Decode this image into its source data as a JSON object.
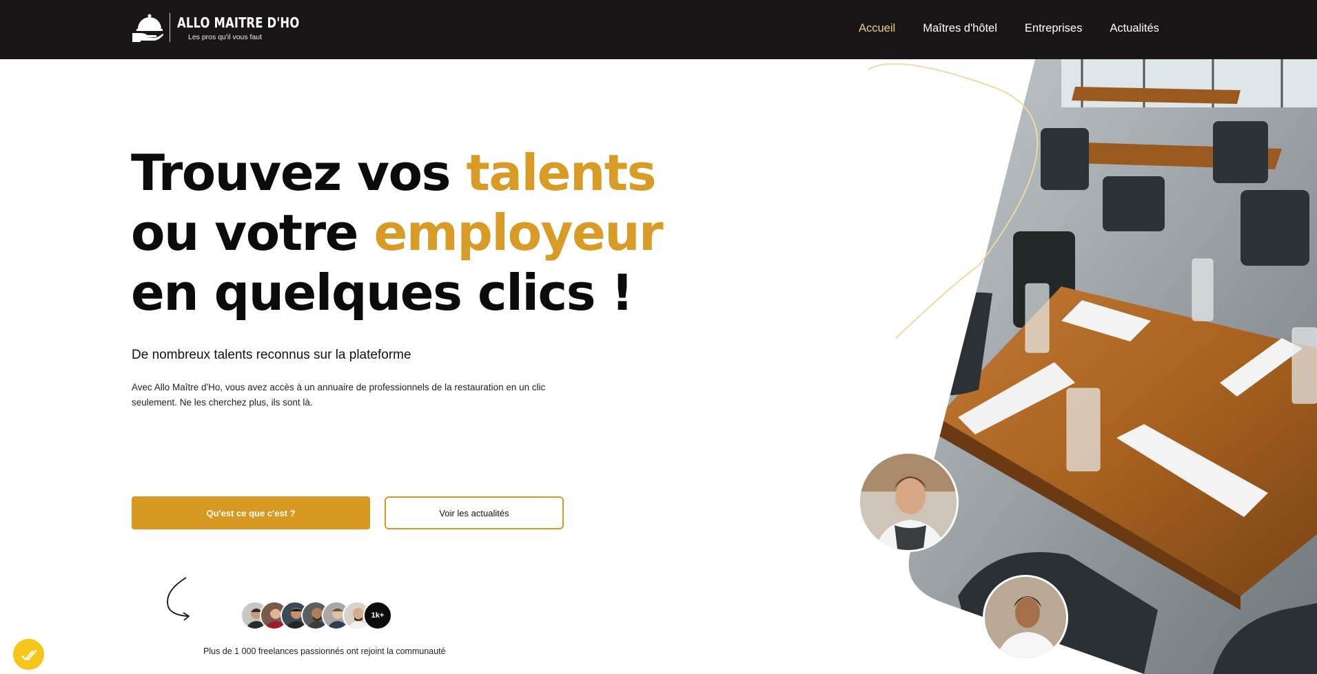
{
  "brand": {
    "name": "ALLO MAITRE D'HO",
    "tagline": "Les pros qu'il vous faut"
  },
  "nav": {
    "items": [
      {
        "label": "Accueil",
        "active": true
      },
      {
        "label": "Maîtres d'hôtel",
        "active": false
      },
      {
        "label": "Entreprises",
        "active": false
      },
      {
        "label": "Actualités",
        "active": false
      }
    ]
  },
  "hero": {
    "title_part1": "Trouvez vos ",
    "title_accent1": "talents",
    "title_part2": " ou votre ",
    "title_accent2": "employeur",
    "title_part3": " en quelques clics !",
    "subtitle": "De nombreux talents reconnus sur la plateforme",
    "description": "Avec Allo Maître d'Ho, vous avez accès à un annuaire de professionnels de la restauration en un clic seulement. Ne les cherchez plus, ils sont là."
  },
  "buttons": {
    "primary": "Qu'est ce que c'est ?",
    "secondary": "Voir les actualités"
  },
  "community": {
    "count_badge": "1k+",
    "text": "Plus de 1 000 freelances passionnés ont rejoint la communauté"
  },
  "colors": {
    "accent": "#d89b26",
    "header_bg": "#1a1617",
    "nav_active": "#e8cf84",
    "chat_widget": "#f5c518"
  },
  "icons": {
    "logo": "cloche-serving-icon",
    "arrow": "curved-arrow-icon",
    "chat": "chat-check-icon"
  }
}
